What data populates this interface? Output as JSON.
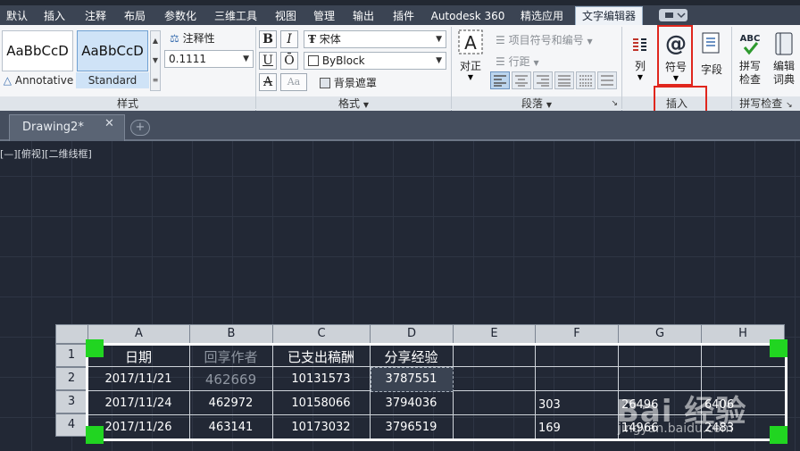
{
  "ribbon_tabs": [
    {
      "label": "默认"
    },
    {
      "label": "插入"
    },
    {
      "label": "注释"
    },
    {
      "label": "布局"
    },
    {
      "label": "参数化"
    },
    {
      "label": "三维工具"
    },
    {
      "label": "视图"
    },
    {
      "label": "管理"
    },
    {
      "label": "输出"
    },
    {
      "label": "插件"
    },
    {
      "label": "Autodesk 360"
    },
    {
      "label": "精选应用"
    },
    {
      "label": "文字编辑器"
    }
  ],
  "style_panel": {
    "title": "样式",
    "styles": [
      {
        "preview": "AaBbCcD",
        "name": "Annotative",
        "selected": false
      },
      {
        "preview": "AaBbCcD",
        "name": "Standard",
        "selected": true
      }
    ],
    "annotative_label": "注释性",
    "text_height": "0.1111"
  },
  "format_panel": {
    "title": "格式",
    "bold": "B",
    "italic": "I",
    "underline": "U",
    "overline": "Ō",
    "strike": "A",
    "case": "Aa",
    "font_name": "宋体",
    "color_name": "ByBlock",
    "mask_label": "背景遮罩"
  },
  "paragraph_panel": {
    "title": "段落",
    "justify_label": "对正",
    "bullets_label": "项目符号和编号",
    "line_spacing_label": "行距"
  },
  "insert_panel": {
    "title": "插入",
    "columns_label": "列",
    "symbol_label": "符号",
    "field_label": "字段"
  },
  "spell_panel": {
    "title": "拼写检查",
    "spell_check_label": "拼写\n检查",
    "edit_dict_label": "编辑\n词典"
  },
  "document_tab": {
    "label": "Drawing2*"
  },
  "viewport_label": "[—][俯视][二维线框]",
  "table": {
    "columns": [
      "A",
      "B",
      "C",
      "D",
      "E",
      "F",
      "G",
      "H"
    ],
    "row_numbers": [
      "1",
      "2",
      "3",
      "4"
    ],
    "header_row": [
      "日期",
      "回享作者",
      "已支出稿酬",
      "分享经验"
    ],
    "rows": [
      [
        "2017/11/21",
        "462669",
        "10131573",
        "3787551",
        "",
        "",
        "",
        ""
      ],
      [
        "2017/11/24",
        "462972",
        "10158066",
        "3794036",
        "",
        "303",
        "26496",
        "6406"
      ],
      [
        "2017/11/26",
        "463141",
        "10173032",
        "3796519",
        "",
        "169",
        "14966",
        "2483"
      ]
    ]
  },
  "watermark": {
    "brand": "Bai 经验",
    "url": "jingyan.baidu.com"
  },
  "colors": {
    "grip": "#21d521",
    "highlight": "#e0261d",
    "selected_style": "#cfe3f7"
  }
}
